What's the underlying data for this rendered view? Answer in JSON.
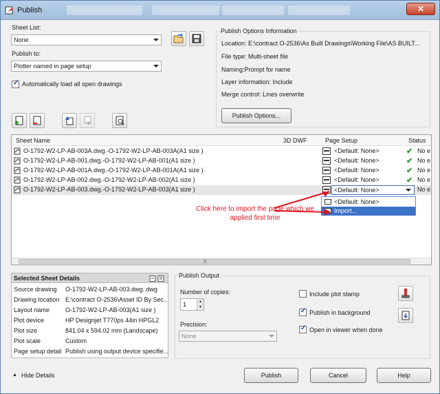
{
  "window": {
    "title": "Publish",
    "close_label": "✕"
  },
  "sheet_list": {
    "label": "Sheet List:",
    "value": "None"
  },
  "publish_to": {
    "label": "Publish to:",
    "value": "Plotter named in page setup"
  },
  "auto_load": {
    "label": "Automatically load all open drawings",
    "checked": true
  },
  "options_info": {
    "title": "Publish Options Information",
    "location": "Location: E:\\contract O-2536\\As Built Drawings\\Working File\\AS BUILT...",
    "file_type": "File type: Multi-sheet file",
    "naming": "Naming:Prompt for name",
    "layer_info": "Layer information: Include",
    "merge_control": "Merge control: Lines overwrite",
    "button": "Publish Options..."
  },
  "grid": {
    "headers": {
      "sheet_name": "Sheet Name",
      "dwf": "3D DWF",
      "page_setup": "Page Setup",
      "status": "Status"
    },
    "rows": [
      {
        "name": "O-1792-W2-LP-AB-003A.dwg.-O-1792-W2-LP-AB-003A(A1 size )",
        "page_setup": "<Default: None>",
        "status": "No e"
      },
      {
        "name": "O-1792-W2-LP-AB-001.dwg.-O-1792-W2-LP-AB-001(A1 size )",
        "page_setup": "<Default: None>",
        "status": "No e"
      },
      {
        "name": "O-1792-W2-LP-AB-001A.dwg.-O-1792-W2-LP-AB-001A(A1 size )",
        "page_setup": "<Default: None>",
        "status": "No e"
      },
      {
        "name": "O-1792-W2-LP-AB-002.dwg.-O-1792-W2-LP-AB-002(A1 size )",
        "page_setup": "<Default: None>",
        "status": "No e"
      },
      {
        "name": "O-1792-W2-LP-AB-003.dwg.-O-1792-W2-LP-AB-003(A1 size )",
        "page_setup": "<Default: None>",
        "status": "No e"
      }
    ],
    "dropdown": [
      "<Default: None>",
      "Import..."
    ]
  },
  "annotation": "Click here to import the page which we applied first time",
  "selected_details": {
    "title": "Selected Sheet Details",
    "rows": [
      {
        "k": "Source drawing",
        "v": "O-1792-W2-LP-AB-003.dwg..dwg"
      },
      {
        "k": "Drawing location",
        "v": "E:\\contract O-2536\\Asset ID By Sec..."
      },
      {
        "k": "Layout name",
        "v": "O-1792-W2-LP-AB-003(A1 size )"
      },
      {
        "k": "Plot device",
        "v": "HP Designjet T770ps 44in HPGL2"
      },
      {
        "k": "Plot size",
        "v": "841.04 x 594.02 mm (Landscape)"
      },
      {
        "k": "Plot scale",
        "v": "Custom"
      },
      {
        "k": "Page setup detail",
        "v": "Publish using output device specifie..."
      }
    ]
  },
  "publish_output": {
    "title": "Publish Output",
    "copies_label": "Number of copies:",
    "copies_value": "1",
    "precision_label": "Precision:",
    "precision_value": "None",
    "plot_stamp": {
      "label": "Include plot stamp",
      "checked": false
    },
    "background": {
      "label": "Publish in background",
      "checked": true
    },
    "viewer": {
      "label": "Open in viewer when done",
      "checked": true
    }
  },
  "footer": {
    "hide_details": "Hide Details",
    "publish": "Publish",
    "cancel": "Cancel",
    "help": "Help"
  }
}
